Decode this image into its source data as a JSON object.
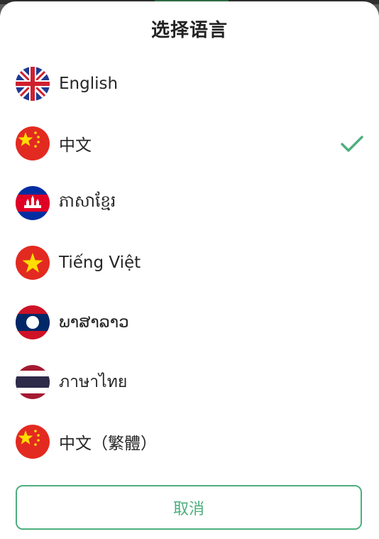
{
  "dialog": {
    "title": "选择语言",
    "cancel_label": "取消",
    "accent_color": "#4caf7d"
  },
  "languages": [
    {
      "label": "English",
      "flag": "uk-flag-icon",
      "selected": false
    },
    {
      "label": "中文",
      "flag": "china-flag-icon",
      "selected": true
    },
    {
      "label": "ភាសាខ្មែរ",
      "flag": "cambodia-flag-icon",
      "selected": false
    },
    {
      "label": "Tiếng Việt",
      "flag": "vietnam-flag-icon",
      "selected": false
    },
    {
      "label": "ພາສາລາວ",
      "flag": "laos-flag-icon",
      "selected": false
    },
    {
      "label": "ภาษาไทย",
      "flag": "thailand-flag-icon",
      "selected": false
    },
    {
      "label": "中文（繁體）",
      "flag": "china-flag-icon",
      "selected": false
    }
  ]
}
